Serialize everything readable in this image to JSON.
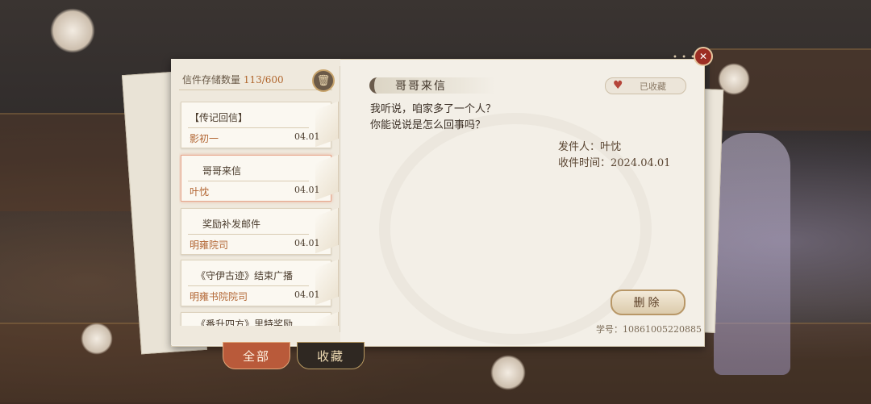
{
  "storage": {
    "label": "信件存储数量",
    "count": "113/600"
  },
  "letters": [
    {
      "title": "【传记回信】",
      "sender": "影初一",
      "date": "04.01"
    },
    {
      "title": "哥哥来信",
      "sender": "叶忱",
      "date": "04.01"
    },
    {
      "title": "奖励补发邮件",
      "sender": "明雍院司",
      "date": "04.01"
    },
    {
      "title": "《守伊古迹》结束广播",
      "sender": "明雍书院院司",
      "date": "04.01"
    },
    {
      "title": "《番升四方》里特奖励",
      "sender": "",
      "date": ""
    }
  ],
  "tabs": {
    "all": "全部",
    "favorites": "收藏"
  },
  "detail": {
    "title": "哥哥来信",
    "favorite_label": "已收藏",
    "body_line1": "我听说，咱家多了一个人？",
    "body_line2": "你能说说是怎么回事吗？",
    "sender_line": "发件人：叶忱",
    "received_line": "收件时间：2024.04.01",
    "delete_label": "删除",
    "student_id": "学号：10861005220885"
  },
  "colors": {
    "accent": "#b0652c",
    "tab_active": "#b95a3a",
    "close": "#9c2e24"
  },
  "icons": {
    "trash": "trash-icon",
    "heart": "heart-icon",
    "close": "close-icon"
  }
}
